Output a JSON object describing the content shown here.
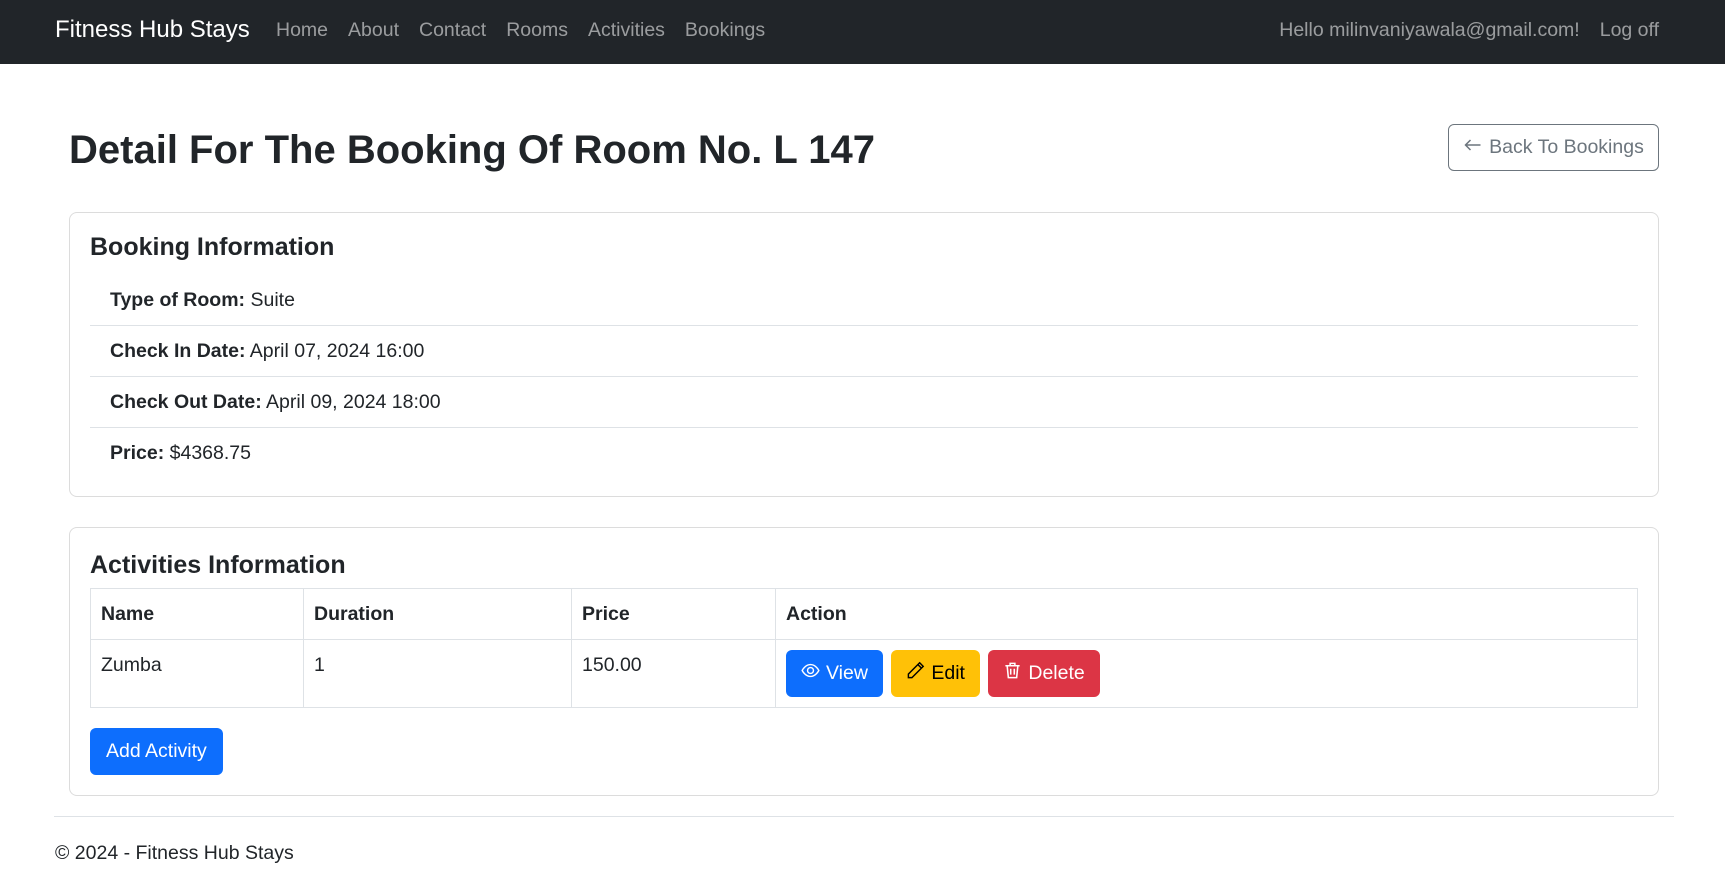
{
  "nav": {
    "brand": "Fitness Hub Stays",
    "links": [
      "Home",
      "About",
      "Contact",
      "Rooms",
      "Activities",
      "Bookings"
    ],
    "greeting": "Hello milinvaniyawala@gmail.com!",
    "logoff": "Log off"
  },
  "page": {
    "title": "Detail For The Booking Of Room No. L 147",
    "back_label": "Back To Bookings"
  },
  "booking": {
    "heading": "Booking Information",
    "items": [
      {
        "label": "Type of Room:",
        "value": "Suite"
      },
      {
        "label": "Check In Date:",
        "value": "April 07, 2024 16:00"
      },
      {
        "label": "Check Out Date:",
        "value": "April 09, 2024 18:00"
      },
      {
        "label": "Price:",
        "value": "$4368.75"
      }
    ]
  },
  "activities": {
    "heading": "Activities Information",
    "columns": [
      "Name",
      "Duration",
      "Price",
      "Action"
    ],
    "rows": [
      {
        "name": "Zumba",
        "duration": "1",
        "price": "150.00"
      }
    ],
    "view_label": "View",
    "edit_label": "Edit",
    "delete_label": "Delete",
    "add_label": "Add Activity"
  },
  "footer": {
    "text": "© 2024 - Fitness Hub Stays"
  },
  "colors": {
    "navbar": "#212529",
    "primary": "#0d6efd",
    "warning": "#ffc107",
    "danger": "#dc3545",
    "secondary": "#6c757d"
  },
  "icons": {
    "back": "arrow-left-icon",
    "view": "eye-icon",
    "edit": "pencil-icon",
    "delete": "trash-icon"
  }
}
